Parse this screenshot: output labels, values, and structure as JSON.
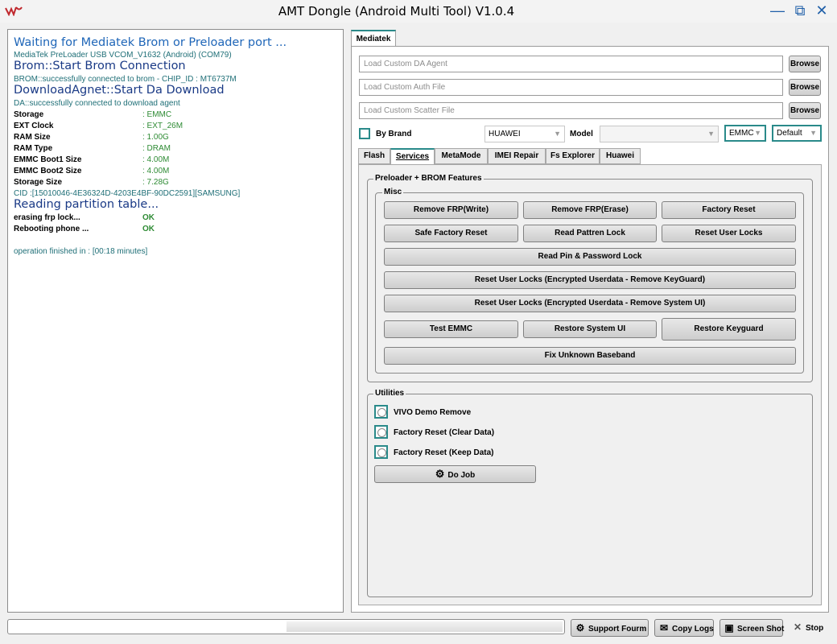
{
  "window": {
    "title": "AMT Dongle (Android Multi Tool) V1.0.4",
    "minimize": "—",
    "maximize": "⧉",
    "close": "✕"
  },
  "log": {
    "lines": [
      "Waiting for Mediatek Brom or Preloader port ...",
      "MediaTek PreLoader USB VCOM_V1632 (Android) (COM79)",
      "Brom::Start Brom Connection",
      "BROM::successfully connected to brom - CHIP_ID : MT6737M",
      "DownloadAgnet::Start Da Download",
      "DA::successfully connected to download agent"
    ],
    "info": [
      {
        "key": "Storage",
        "value": ": EMMC"
      },
      {
        "key": "EXT Clock",
        "value": ": EXT_26M"
      },
      {
        "key": "RAM Size",
        "value": ": 1.00G"
      },
      {
        "key": "RAM Type",
        "value": ": DRAM"
      },
      {
        "key": "EMMC Boot1 Size",
        "value": ": 4.00M"
      },
      {
        "key": "EMMC Boot2 Size",
        "value": ": 4.00M"
      },
      {
        "key": "Storage Size",
        "value": ": 7.28G"
      }
    ],
    "cid": "CID :[15010046-4E36324D-4203E4BF-90DC2591][SAMSUNG]",
    "partition": "Reading partition table...",
    "steps": [
      {
        "label": "erasing frp lock...",
        "status": "OK"
      },
      {
        "label": "Rebooting phone ...",
        "status": "OK"
      }
    ],
    "finished": "operation finished in : [00:18 minutes]"
  },
  "mediatek_tab": "Mediatek",
  "paths": [
    {
      "placeholder": "Load Custom DA Agent",
      "button": "Browse"
    },
    {
      "placeholder": "Load Custom Auth File",
      "button": "Browse"
    },
    {
      "placeholder": "Load Custom Scatter File",
      "button": "Browse"
    }
  ],
  "device": {
    "by_brand_label": "By Brand",
    "brand": "HUAWEI",
    "model_label": "Model",
    "model": "",
    "storage": "EMMC",
    "mode": "Default",
    "arrow": "▼"
  },
  "subtabs": [
    "Flash",
    "Services",
    "MetaMode",
    "IMEI Repair",
    "Fs Explorer",
    "Huawei"
  ],
  "features": {
    "group_title": "Preloader + BROM Features",
    "misc_title": "Misc",
    "buttons": {
      "remove_frp_write": "Remove FRP(Write)",
      "remove_frp_erase": "Remove FRP(Erase)",
      "factory_reset": "Factory Reset",
      "safe_factory_reset": "Safe Factory Reset",
      "read_pattern_lock": "Read Pattren Lock",
      "reset_user_locks": "Reset User Locks",
      "read_pin_password": "Read Pin & Password Lock",
      "reset_keyguard": "Reset User Locks (Encrypted Userdata - Remove KeyGuard)",
      "reset_system_ui": "Reset User Locks (Encrypted Userdata - Remove System UI)",
      "test_emmc": "Test EMMC",
      "restore_system_ui": "Restore System UI",
      "restore_keyguard": "Restore Keyguard",
      "fix_baseband": "Fix Unknown Baseband"
    }
  },
  "utilities": {
    "title": "Utilities",
    "options": [
      "VIVO Demo Remove",
      "Factory Reset (Clear Data)",
      "Factory Reset (Keep Data)"
    ],
    "do_job": "Do Job"
  },
  "bottom": {
    "progress": 0.5,
    "support": "Support Fourm",
    "copy_logs": "Copy Logs",
    "screenshot": "Screen Shot",
    "stop": "Stop"
  },
  "colors": {
    "accent_teal": "#2a8a8a",
    "log_blue": "#1a3a86",
    "ok_green": "#2e8b34"
  }
}
